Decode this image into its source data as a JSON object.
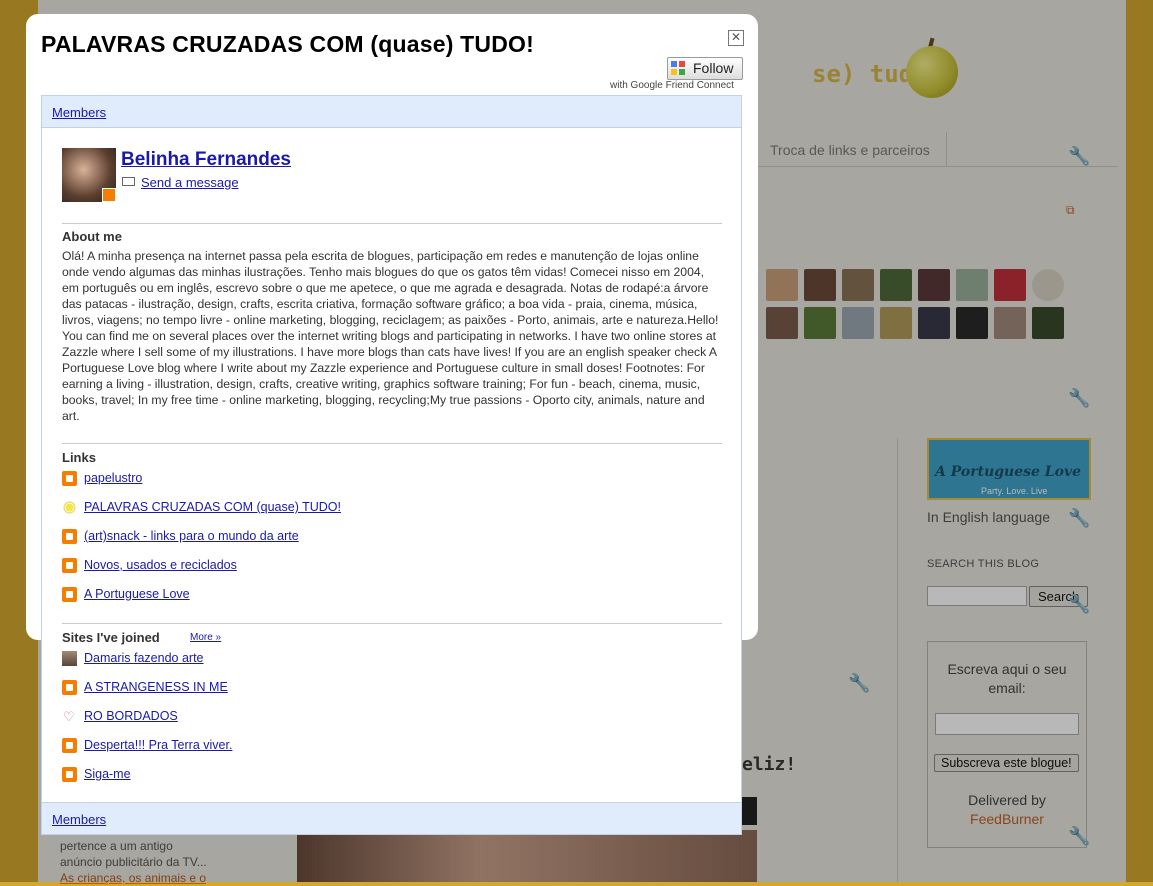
{
  "background": {
    "title_fragment": "se) tudo!",
    "nav_item": "Troca de links e parceiros",
    "banner": {
      "title": "A Portuguese Love",
      "tagline": "Party. Love. Live"
    },
    "banner_caption": "In English language",
    "search_heading": "SEARCH THIS BLOG",
    "search_button": "Search",
    "subscribe_prompt": "Escreva aqui o seu email:",
    "subscribe_button": "Subscreva este blogue!",
    "delivered_by": "Delivered by",
    "feedburner": "FeedBurner",
    "post_title_fragment": "eliz!",
    "bottom_left_line1": "pertence a um antigo",
    "bottom_left_line2": "anúncio publicitário da TV...",
    "bottom_left_link": "As crianças, os animais e o"
  },
  "modal": {
    "title": "PALAVRAS CRUZADAS COM (quase) TUDO!",
    "close_symbol": "✕",
    "follow_label": "Follow",
    "gfc_caption": "with Google Friend Connect",
    "top_bar_label": "Members",
    "bottom_bar_label": "Members",
    "profile": {
      "name": "Belinha Fernandes",
      "send_message": "Send a message"
    },
    "about_heading": "About me",
    "about_text": "Olá! A minha presença na internet passa pela escrita de blogues, participação em redes e manutenção de lojas online onde vendo algumas das minhas ilustrações. Tenho mais blogues do que os gatos têm vidas! Comecei nisso em 2004, em português ou em inglês, escrevo sobre o que me apetece, o que me agrada e desagrada. Notas de rodapé:a árvore das patacas - ilustração, design, crafts, escrita criativa, formação software gráfico; a boa vida - praia, cinema, música, livros, viagens; no tempo livre - online marketing, blogging, reciclagem; as paixões - Porto, animais, arte e natureza.Hello! You can find me on several places over the internet writing blogs and participating in networks. I have two online stores at Zazzle where I sell some of my illustrations. I have more blogs than cats have lives! If you are an english speaker check A Portuguese Love blog where I write about my Zazzle experience and Portuguese culture in small doses! Footnotes: For earning a living - illustration, design, crafts, creative writing, graphics software training; For fun - beach, cinema, music, books, travel; In my free time - online marketing, blogging, recycling;My true passions - Oporto city, animals, nature and art.",
    "links_heading": "Links",
    "links": [
      {
        "label": "papelustro",
        "icon": "blogger-icon"
      },
      {
        "label": "PALAVRAS CRUZADAS COM (quase) TUDO!",
        "icon": "sun-icon"
      },
      {
        "label": "(art)snack - links para o mundo da arte",
        "icon": "blogger-icon"
      },
      {
        "label": "Novos, usados e reciclados",
        "icon": "blogger-icon"
      },
      {
        "label": "A Portuguese Love",
        "icon": "blogger-icon"
      }
    ],
    "sites_heading": "Sites I've joined",
    "more_label": "More »",
    "sites": [
      {
        "label": "Damaris fazendo arte",
        "icon": "avatar-icon"
      },
      {
        "label": "A STRANGENESS IN ME",
        "icon": "blogger-icon"
      },
      {
        "label": "RO BORDADOS",
        "icon": "heart-icon"
      },
      {
        "label": "Desperta!!! Pra Terra viver.",
        "icon": "blogger-icon"
      },
      {
        "label": "Siga-me",
        "icon": "blogger-icon"
      }
    ]
  },
  "colors": {
    "link": "#1a1aa8",
    "bar": "#e0ecfb",
    "blogger": "#f57d00",
    "page_border": "#d3a82e"
  }
}
